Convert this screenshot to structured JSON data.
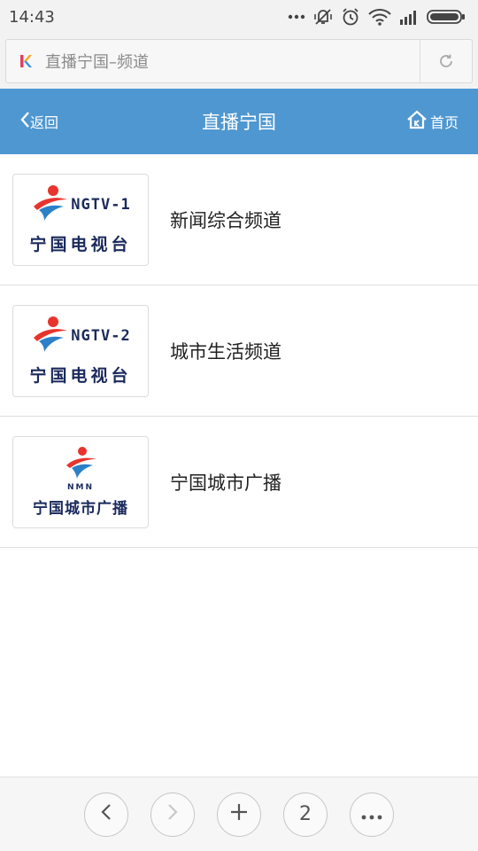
{
  "status_bar": {
    "time": "14:43",
    "icons": [
      "more-dots-icon",
      "mute-vibrate-icon",
      "alarm-icon",
      "wifi-icon",
      "signal-icon",
      "battery-icon"
    ]
  },
  "browser": {
    "url_text": "直播宁国–频道",
    "icons": [
      "k-logo-icon",
      "reload-icon"
    ]
  },
  "header": {
    "back_label": "返回",
    "title": "直播宁国",
    "home_label": "首页",
    "background": "#4f97d0"
  },
  "channels": [
    {
      "name": "新闻综合频道",
      "logo_code": "NGTV-1",
      "logo_name": "宁国电视台"
    },
    {
      "name": "城市生活频道",
      "logo_code": "NGTV-2",
      "logo_name": "宁国电视台"
    },
    {
      "name": "宁国城市广播",
      "logo_code": "NMN",
      "logo_name": "宁国城市广播"
    }
  ],
  "bottom_nav": {
    "tab_count": "2",
    "icons": [
      "back-arrow-icon",
      "forward-arrow-icon",
      "plus-icon",
      "tab-count",
      "more-icon"
    ]
  }
}
